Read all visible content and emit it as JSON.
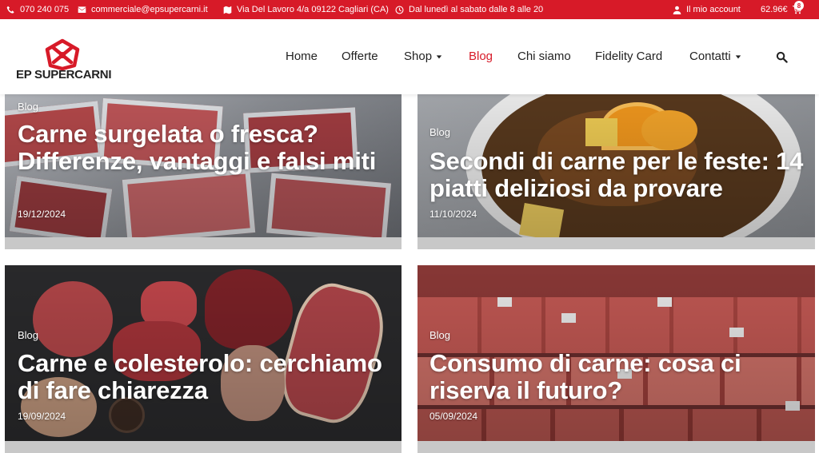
{
  "topbar": {
    "phone": "070 240 075",
    "email": "commerciale@epsupercarni.it",
    "address": "Via Del Lavoro 4/a 09122 Cagliari (CA)",
    "hours": "Dal lunedì al sabato dalle 8 alle 20",
    "account": "Il mio account",
    "cart_total": "62.96€",
    "cart_count": "8"
  },
  "brand": {
    "name": "EP SUPERCARNI",
    "color": "#d71a28"
  },
  "nav": [
    {
      "label": "Home"
    },
    {
      "label": "Offerte"
    },
    {
      "label": "Shop"
    },
    {
      "label": "Blog"
    },
    {
      "label": "Chi siamo"
    },
    {
      "label": "Fidelity Card"
    },
    {
      "label": "Contatti"
    }
  ],
  "posts": [
    {
      "category": "Blog",
      "title": "Carne surgelata o fresca? Differenze, vantaggi e falsi miti",
      "date": "19/12/2024"
    },
    {
      "category": "Blog",
      "title": "Secondi di carne per le feste: 14 piatti deliziosi da provare",
      "date": "11/10/2024"
    },
    {
      "category": "Blog",
      "title": "Carne e colesterolo: cerchiamo di fare chiarezza",
      "date": "19/09/2024"
    },
    {
      "category": "Blog",
      "title": "Consumo di carne: cosa ci riserva il futuro?",
      "date": "05/09/2024"
    }
  ]
}
